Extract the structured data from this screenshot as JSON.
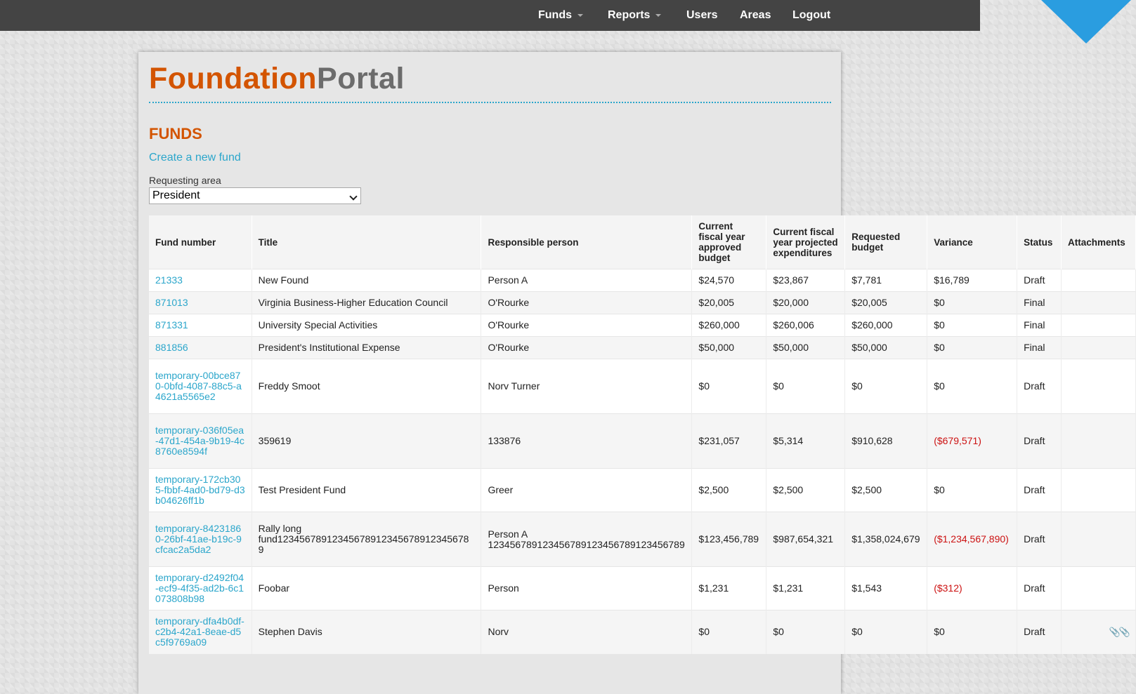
{
  "nav": {
    "funds": "Funds",
    "reports": "Reports",
    "users": "Users",
    "areas": "Areas",
    "logout": "Logout"
  },
  "logo": {
    "part1": "Foundation",
    "part2": "Portal"
  },
  "page": {
    "title": "FUNDS",
    "create_link": "Create a new fund",
    "area_label": "Requesting area",
    "area_value": "President"
  },
  "table": {
    "headers": [
      "Fund number",
      "Title",
      "Responsible person",
      "Current fiscal year approved budget",
      "Current fiscal year projected expenditures",
      "Requested budget",
      "Variance",
      "Status",
      "Attachments"
    ],
    "rows": [
      {
        "fund": "21333",
        "title": "New Found",
        "person": "Person A",
        "approved": "$24,570",
        "projected": "$23,867",
        "requested": "$7,781",
        "variance": "$16,789",
        "status": "Draft",
        "attachments": ""
      },
      {
        "fund": "871013",
        "title": "Virginia Business-Higher Education Council",
        "person": "O'Rourke",
        "approved": "$20,005",
        "projected": "$20,000",
        "requested": "$20,005",
        "variance": "$0",
        "status": "Final",
        "attachments": ""
      },
      {
        "fund": "871331",
        "title": "University Special Activities",
        "person": "O'Rourke",
        "approved": "$260,000",
        "projected": "$260,006",
        "requested": "$260,000",
        "variance": "$0",
        "status": "Final",
        "attachments": ""
      },
      {
        "fund": "881856",
        "title": "President's Institutional Expense",
        "person": "O'Rourke",
        "approved": "$50,000",
        "projected": "$50,000",
        "requested": "$50,000",
        "variance": "$0",
        "status": "Final",
        "attachments": ""
      },
      {
        "fund": "temporary-00bce870-0bfd-4087-88c5-a4621a5565e2",
        "title": "Freddy Smoot",
        "person": "Norv Turner",
        "approved": "$0",
        "projected": "$0",
        "requested": "$0",
        "variance": "$0",
        "status": "Draft",
        "attachments": ""
      },
      {
        "fund": "temporary-036f05ea-47d1-454a-9b19-4c8760e8594f",
        "title": "359619",
        "person": "133876",
        "approved": "$231,057",
        "projected": "$5,314",
        "requested": "$910,628",
        "variance": "($679,571)",
        "status": "Draft",
        "attachments": ""
      },
      {
        "fund": "temporary-172cb305-fbbf-4ad0-bd79-d3b04626ff1b",
        "title": "Test President Fund",
        "person": "Greer",
        "approved": "$2,500",
        "projected": "$2,500",
        "requested": "$2,500",
        "variance": "$0",
        "status": "Draft",
        "attachments": ""
      },
      {
        "fund": "temporary-84231860-26bf-41ae-b19c-9cfcac2a5da2",
        "title": "Rally long fund12345678912345678912345678912345678 9",
        "person": "Person A 123456789123456789123456789123456789",
        "approved": "$123,456,789",
        "projected": "$987,654,321",
        "requested": "$1,358,024,679",
        "variance": "($1,234,567,890)",
        "status": "Draft",
        "attachments": ""
      },
      {
        "fund": "temporary-d2492f04-ecf9-4f35-ad2b-6c1073808b98",
        "title": "Foobar",
        "person": "Person",
        "approved": "$1,231",
        "projected": "$1,231",
        "requested": "$1,543",
        "variance": "($312)",
        "status": "Draft",
        "attachments": ""
      },
      {
        "fund": "temporary-dfa4b0df-c2b4-42a1-8eae-d5c5f9769a09",
        "title": "Stephen Davis",
        "person": "Norv",
        "approved": "$0",
        "projected": "$0",
        "requested": "$0",
        "variance": "$0",
        "status": "Draft",
        "attachments": "paperclip-icon"
      }
    ]
  },
  "colors": {
    "topbar": "#444444",
    "accent_orange": "#d35400",
    "link_blue": "#2ba6cb",
    "corner_blue": "#2a9de0",
    "negative_red": "#cc1111"
  }
}
